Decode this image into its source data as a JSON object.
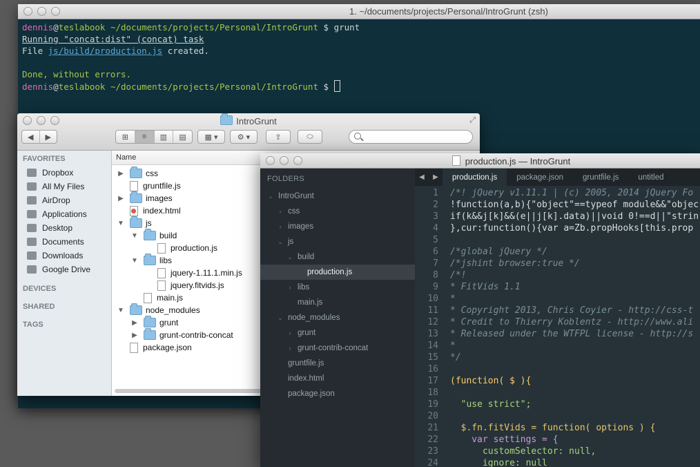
{
  "terminal": {
    "title": "1. ~/documents/projects/Personal/IntroGrunt (zsh)",
    "user": "dennis",
    "at": "@",
    "host": "teslabook",
    "path": "~/documents/projects/Personal/IntroGrunt",
    "prompt_sym": "$",
    "command": "grunt",
    "running": "Running \"concat:dist\" (concat) task",
    "file_prefix": "File ",
    "file_path": "js/build/production.js",
    "file_suffix": " created.",
    "done": "Done, without errors."
  },
  "finder": {
    "title": "IntroGrunt",
    "sidebar": {
      "favorites_header": "FAVORITES",
      "favorites": [
        {
          "label": "Dropbox",
          "icon": "dropbox-icon"
        },
        {
          "label": "All My Files",
          "icon": "all-files-icon"
        },
        {
          "label": "AirDrop",
          "icon": "airdrop-icon"
        },
        {
          "label": "Applications",
          "icon": "applications-icon"
        },
        {
          "label": "Desktop",
          "icon": "desktop-icon"
        },
        {
          "label": "Documents",
          "icon": "documents-icon"
        },
        {
          "label": "Downloads",
          "icon": "downloads-icon"
        },
        {
          "label": "Google Drive",
          "icon": "google-drive-icon"
        }
      ],
      "devices_header": "DEVICES",
      "shared_header": "SHARED",
      "tags_header": "TAGS"
    },
    "column_name": "Name",
    "items": [
      {
        "label": "css",
        "type": "folder",
        "indent": 0,
        "expanded": false
      },
      {
        "label": "gruntfile.js",
        "type": "file",
        "indent": 0
      },
      {
        "label": "images",
        "type": "folder",
        "indent": 0,
        "expanded": false
      },
      {
        "label": "index.html",
        "type": "html",
        "indent": 0
      },
      {
        "label": "js",
        "type": "folder",
        "indent": 0,
        "expanded": true
      },
      {
        "label": "build",
        "type": "folder",
        "indent": 1,
        "expanded": true
      },
      {
        "label": "production.js",
        "type": "file",
        "indent": 2
      },
      {
        "label": "libs",
        "type": "folder",
        "indent": 1,
        "expanded": true
      },
      {
        "label": "jquery-1.11.1.min.js",
        "type": "file",
        "indent": 2
      },
      {
        "label": "jquery.fitvids.js",
        "type": "file",
        "indent": 2
      },
      {
        "label": "main.js",
        "type": "file",
        "indent": 1
      },
      {
        "label": "node_modules",
        "type": "folder",
        "indent": 0,
        "expanded": true
      },
      {
        "label": "grunt",
        "type": "folder",
        "indent": 1,
        "expanded": false
      },
      {
        "label": "grunt-contrib-concat",
        "type": "folder",
        "indent": 1,
        "expanded": false
      },
      {
        "label": "package.json",
        "type": "file",
        "indent": 0
      }
    ]
  },
  "sublime": {
    "title": "production.js — IntroGrunt",
    "folders_header": "FOLDERS",
    "tree": [
      {
        "label": "IntroGrunt",
        "indent": 0,
        "arrow": "down"
      },
      {
        "label": "css",
        "indent": 1,
        "arrow": "right"
      },
      {
        "label": "images",
        "indent": 1,
        "arrow": "right"
      },
      {
        "label": "js",
        "indent": 1,
        "arrow": "down"
      },
      {
        "label": "build",
        "indent": 2,
        "arrow": "down"
      },
      {
        "label": "production.js",
        "indent": 3,
        "arrow": "",
        "selected": true
      },
      {
        "label": "libs",
        "indent": 2,
        "arrow": "right"
      },
      {
        "label": "main.js",
        "indent": 2,
        "arrow": ""
      },
      {
        "label": "node_modules",
        "indent": 1,
        "arrow": "down"
      },
      {
        "label": "grunt",
        "indent": 2,
        "arrow": "right"
      },
      {
        "label": "grunt-contrib-concat",
        "indent": 2,
        "arrow": "right"
      },
      {
        "label": "gruntfile.js",
        "indent": 1,
        "arrow": ""
      },
      {
        "label": "index.html",
        "indent": 1,
        "arrow": ""
      },
      {
        "label": "package.json",
        "indent": 1,
        "arrow": ""
      }
    ],
    "tabs": [
      "production.js",
      "package.json",
      "gruntfile.js",
      "untitled"
    ],
    "active_tab": 0,
    "code": [
      {
        "n": "1",
        "t": "/*! jQuery v1.11.1 | (c) 2005, 2014 jQuery Fo",
        "c": "c-cm"
      },
      {
        "n": "2",
        "t": "!function(a,b){\"object\"==typeof module&&\"objec",
        "c": ""
      },
      {
        "n": "3",
        "t": "if(k&&j[k]&&(e||j[k].data)||void 0!==d||\"strin",
        "c": ""
      },
      {
        "n": "4",
        "t": "},cur:function(){var a=Zb.propHooks[this.prop",
        "c": ""
      },
      {
        "n": "5",
        "t": "",
        "c": ""
      },
      {
        "n": "6",
        "t": "/*global jQuery */",
        "c": "c-cm"
      },
      {
        "n": "7",
        "t": "/*jshint browser:true */",
        "c": "c-cm"
      },
      {
        "n": "8",
        "t": "/*!",
        "c": "c-cm"
      },
      {
        "n": "9",
        "t": "* FitVids 1.1",
        "c": "c-cm"
      },
      {
        "n": "10",
        "t": "*",
        "c": "c-cm"
      },
      {
        "n": "11",
        "t": "* Copyright 2013, Chris Coyier - http://css-t",
        "c": "c-cm"
      },
      {
        "n": "12",
        "t": "* Credit to Thierry Koblentz - http://www.ali",
        "c": "c-cm"
      },
      {
        "n": "13",
        "t": "* Released under the WTFPL license - http://s",
        "c": "c-cm"
      },
      {
        "n": "14",
        "t": "*",
        "c": "c-cm"
      },
      {
        "n": "15",
        "t": "*/",
        "c": "c-cm"
      },
      {
        "n": "16",
        "t": "",
        "c": ""
      },
      {
        "n": "17",
        "t": "(function( $ ){",
        "c": "c-y"
      },
      {
        "n": "18",
        "t": "",
        "c": ""
      },
      {
        "n": "19",
        "t": "  \"use strict\";",
        "c": "c-str"
      },
      {
        "n": "20",
        "t": "",
        "c": ""
      },
      {
        "n": "21",
        "t": "  $.fn.fitVids = function( options ) {",
        "c": "c-fn"
      },
      {
        "n": "22",
        "t": "    var settings = {",
        "c": "c-kw"
      },
      {
        "n": "23",
        "t": "      customSelector: null,",
        "c": "c-pr"
      },
      {
        "n": "24",
        "t": "      ignore: null",
        "c": "c-pr"
      }
    ]
  }
}
